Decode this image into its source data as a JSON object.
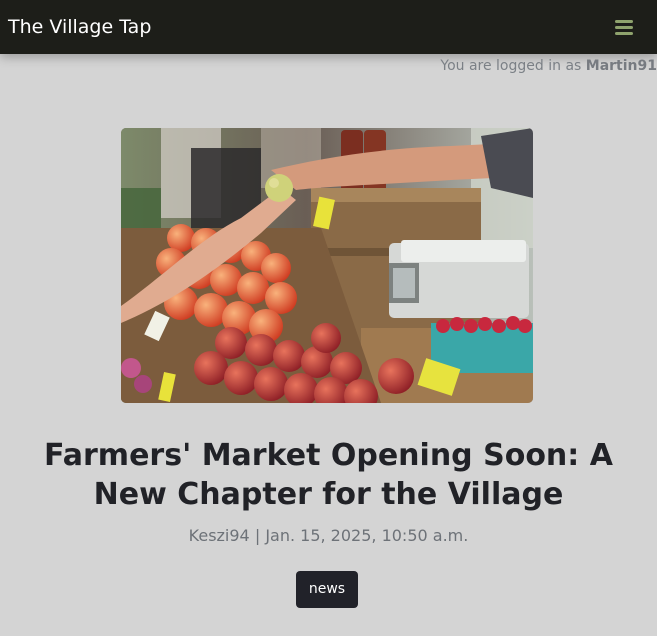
{
  "app": {
    "title": "The Village Tap"
  },
  "navbar": {
    "menu_icon": "hamburger-menu-icon",
    "menu_icon_color": "#8fa36d"
  },
  "session": {
    "prefix": "You are logged in as",
    "username": "Martin91"
  },
  "article": {
    "image_subject": "farmers-market-produce-photo",
    "title": "Farmers' Market Opening Soon: A New Chapter for the Village",
    "author": "Keszi94",
    "separator": "|",
    "date": "Jan. 15, 2025, 10:50 a.m.",
    "tag": "news"
  },
  "colors": {
    "navbar_bg": "#1d1e19",
    "page_bg": "#d4d4d4",
    "tag_bg": "#212229"
  }
}
